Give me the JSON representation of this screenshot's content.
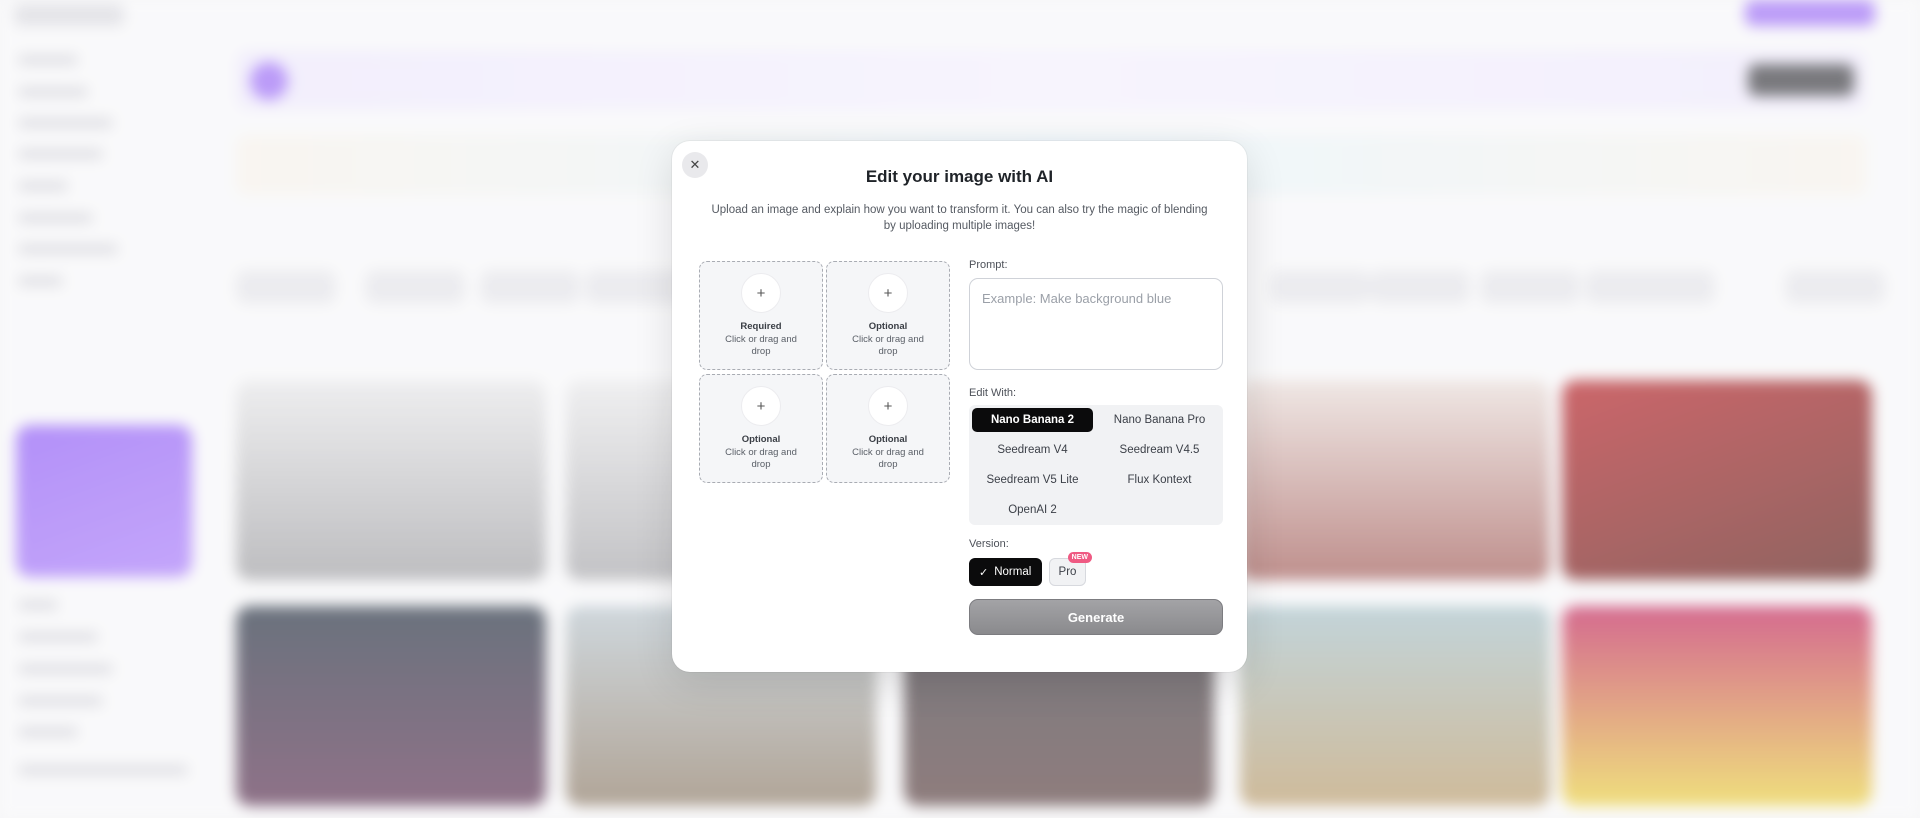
{
  "modal": {
    "close_icon": "close-icon",
    "title": "Edit your image with AI",
    "subtitle": "Upload an image and explain how you want to transform it. You can also try the magic of blending by uploading multiple images!",
    "uploads": [
      {
        "label": "Required",
        "hint": "Click or drag and drop",
        "icon": "plus-icon"
      },
      {
        "label": "Optional",
        "hint": "Click or drag and drop",
        "icon": "plus-icon"
      },
      {
        "label": "Optional",
        "hint": "Click or drag and drop",
        "icon": "plus-icon"
      },
      {
        "label": "Optional",
        "hint": "Click or drag and drop",
        "icon": "plus-icon"
      }
    ],
    "prompt": {
      "label": "Prompt:",
      "placeholder": "Example: Make background blue",
      "value": ""
    },
    "edit_with": {
      "label": "Edit With:",
      "selected": "Nano Banana 2",
      "options": [
        "Nano Banana 2",
        "Nano Banana Pro",
        "Seedream V4",
        "Seedream V4.5",
        "Seedream V5 Lite",
        "Flux Kontext",
        "OpenAI 2"
      ]
    },
    "version": {
      "label": "Version:",
      "normal_label": "Normal",
      "pro_label": "Pro",
      "pro_badge": "NEW",
      "selected": "Normal",
      "check_icon": "check-icon"
    },
    "generate_label": "Generate"
  },
  "colors": {
    "accent_dark": "#0b0b0c",
    "generate_bg": "#959598",
    "badge_pink": "#ef5a83",
    "promo_purple": "#9b6cf5"
  }
}
